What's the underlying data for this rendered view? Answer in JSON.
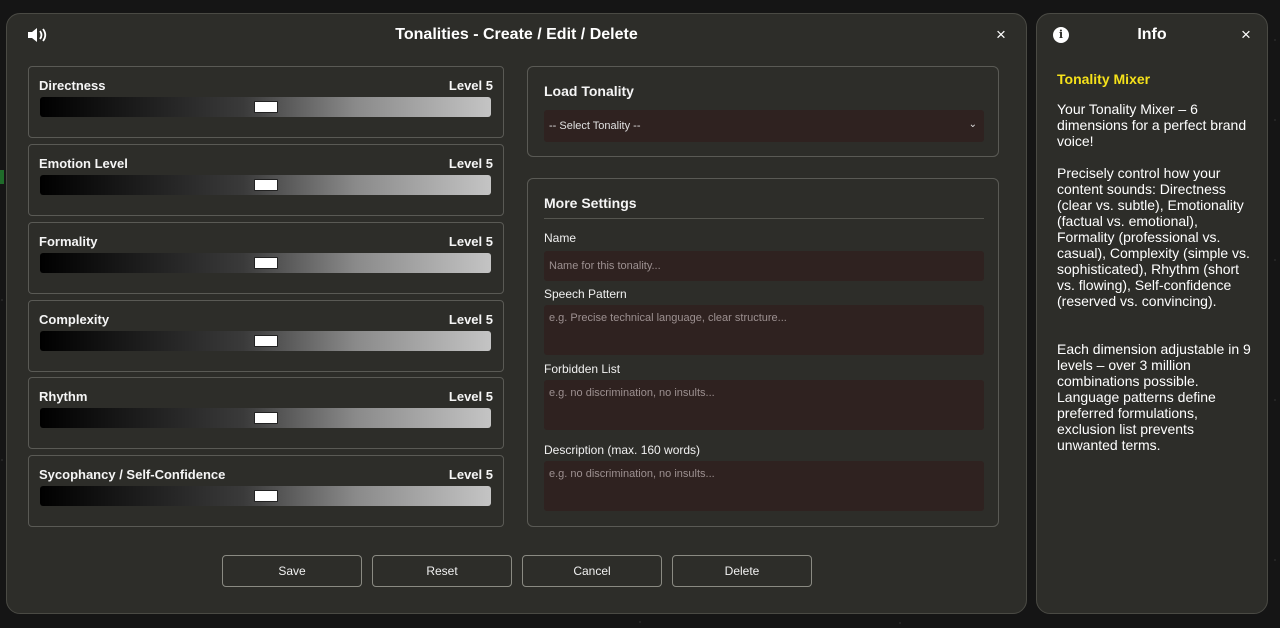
{
  "modal": {
    "title": "Tonalities - Create / Edit / Delete",
    "close_symbol": "×"
  },
  "sliders": [
    {
      "label": "Directness",
      "level_text": "Level 5",
      "level": 5
    },
    {
      "label": "Emotion Level",
      "level_text": "Level 5",
      "level": 5
    },
    {
      "label": "Formality",
      "level_text": "Level 5",
      "level": 5
    },
    {
      "label": "Complexity",
      "level_text": "Level 5",
      "level": 5
    },
    {
      "label": "Rhythm",
      "level_text": "Level 5",
      "level": 5
    },
    {
      "label": "Sycophancy / Self-Confidence",
      "level_text": "Level 5",
      "level": 5
    }
  ],
  "slider_scale": {
    "min": 1,
    "max": 9
  },
  "load": {
    "title": "Load Tonality",
    "select_value": "-- Select Tonality --"
  },
  "settings": {
    "title": "More Settings",
    "name_label": "Name",
    "name_placeholder": "Name for this tonality...",
    "speech_label": "Speech Pattern",
    "speech_placeholder": "e.g. Precise technical language, clear structure...",
    "forbidden_label": "Forbidden List",
    "forbidden_placeholder": "e.g. no discrimination, no insults...",
    "description_label": "Description (max. 160 words)",
    "description_placeholder": "e.g. no discrimination, no insults..."
  },
  "buttons": {
    "save": "Save",
    "reset": "Reset",
    "cancel": "Cancel",
    "delete": "Delete"
  },
  "info": {
    "icon": "i",
    "title": "Info",
    "close_symbol": "×",
    "heading": "Tonality Mixer",
    "para1": "Your Tonality Mixer – 6 dimensions for a perfect brand voice!",
    "para2": "Precisely control how your content sounds: Directness (clear vs. subtle), Emotionality (factual vs. emotional), Formality (professional vs. casual), Complexity (simple vs. sophisticated), Rhythm (short vs. flowing), Self-confidence (reserved vs. convincing).",
    "para3": "Each dimension adjustable in 9 levels – over 3 million combinations possible. Language patterns define preferred formulations, exclusion list prevents unwanted terms."
  },
  "colors": {
    "background": "#151515",
    "panel": "#2d2d29",
    "field": "#2f2220",
    "accent_heading": "#f5e11a"
  },
  "icons": {
    "sound": "speaker-volume-icon",
    "info": "info-circle-icon",
    "close": "close-icon",
    "select": "chevron-down-icon"
  }
}
